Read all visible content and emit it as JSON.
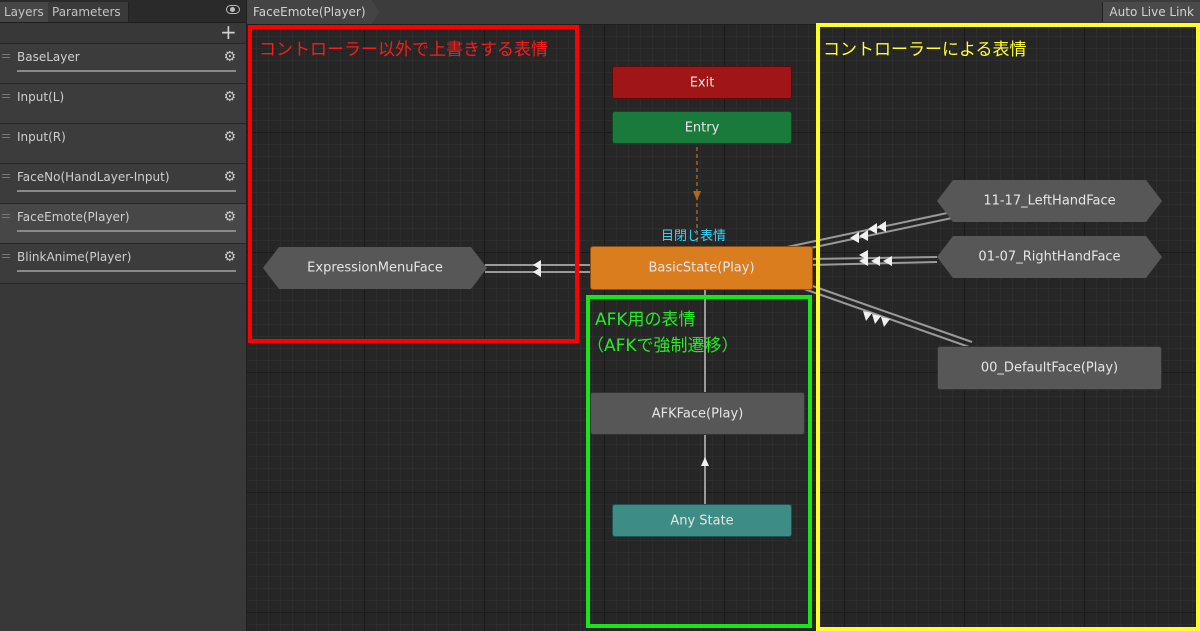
{
  "tabs": {
    "layers": "Layers",
    "parameters": "Parameters"
  },
  "add_label": "+",
  "layers": [
    {
      "name": "BaseLayer"
    },
    {
      "name": "Input(L)"
    },
    {
      "name": "Input(R)"
    },
    {
      "name": "FaceNo(HandLayer-Input)"
    },
    {
      "name": "FaceEmote(Player)"
    },
    {
      "name": "BlinkAnime(Player)"
    }
  ],
  "selected_layer": "FaceEmote(Player)",
  "breadcrumb": "FaceEmote(Player)",
  "auto_live_link": "Auto Live Link",
  "states": {
    "exit": "Exit",
    "entry": "Entry",
    "basic": "BasicState(Play)",
    "expression": "ExpressionMenuFace",
    "left_hand": "11-17_LeftHandFace",
    "right_hand": "01-07_RightHandFace",
    "default_face": "00_DefaultFace(Play)",
    "afk": "AFKFace(Play)",
    "any": "Any State"
  },
  "annotations": {
    "red": "コントローラー以外で上書きする表情",
    "yellow": "コントローラーによる表情",
    "green_line1": "AFK用の表情",
    "green_line2": "（AFKで強制遷移）",
    "eyes_closed": "目閉じ表情"
  },
  "colors": {
    "red": "#ff0000",
    "yellow": "#ffff22",
    "green": "#19e619",
    "cyan": "#33d6ff",
    "exit": "#a01616",
    "entry": "#1a7a3c",
    "basic": "#d97d1e",
    "any": "#3d8c85"
  }
}
